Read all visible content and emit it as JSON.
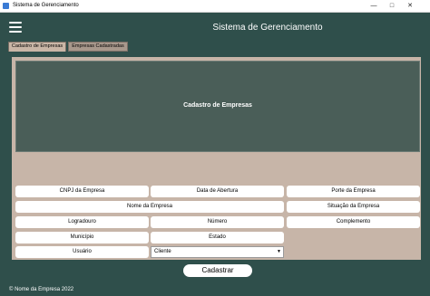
{
  "window": {
    "title": "Sistema de Gerenciamento"
  },
  "header": {
    "title": "Sistema de Gerenciamento"
  },
  "tabs": [
    {
      "label": "Cadastro de Empresas",
      "active": true
    },
    {
      "label": "Empresas Cadastradas",
      "active": false
    }
  ],
  "banner": {
    "title": "Cadastro de Empresas"
  },
  "fields": {
    "cnpj": "CNPJ da Empresa",
    "data_abertura": "Data de Abertura",
    "porte": "Porte da Empresa",
    "nome": "Nome da Empresa",
    "situacao": "Situação da Empresa",
    "logradouro": "Logradouro",
    "numero": "Número",
    "complemento": "Complemento",
    "municipio": "Município",
    "estado": "Estado",
    "usuario": "Usuário"
  },
  "user_type_select": {
    "value": "Cliente"
  },
  "submit": {
    "label": "Cadastrar"
  },
  "footer": {
    "text": "© Nome da Empresa 2022"
  },
  "colors": {
    "background": "#2f4f4b",
    "panel": "#c7b5a8",
    "banner": "#4a5e58"
  }
}
